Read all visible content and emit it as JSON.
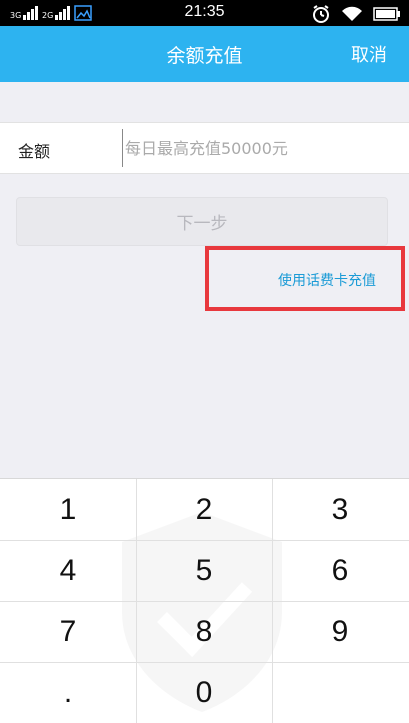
{
  "status_bar": {
    "time": "21:35",
    "signal_labels": [
      "3G",
      "2G"
    ]
  },
  "header": {
    "title": "余额充值",
    "cancel_label": "取消"
  },
  "amount": {
    "label": "金额",
    "placeholder": "每日最高充值50000元"
  },
  "next_button": {
    "label": "下一步"
  },
  "phone_card_link": {
    "label": "使用话费卡充值"
  },
  "keypad": {
    "keys": [
      "1",
      "2",
      "3",
      "4",
      "5",
      "6",
      "7",
      "8",
      "9",
      ".",
      "0",
      ""
    ]
  },
  "colors": {
    "header_bg": "#2db3f0",
    "link": "#1b9bd6",
    "highlight": "#e8383d"
  }
}
